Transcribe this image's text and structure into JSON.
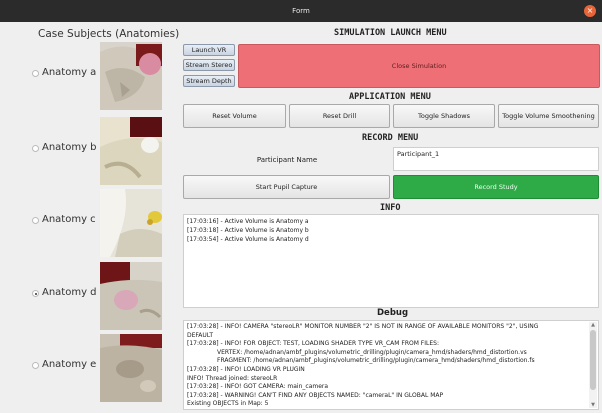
{
  "window": {
    "title": "Form"
  },
  "left_panel": {
    "title": "Case Subjects (Anatomies)",
    "items": [
      {
        "label": "Anatomy a",
        "checked": false
      },
      {
        "label": "Anatomy b",
        "checked": false
      },
      {
        "label": "Anatomy c",
        "checked": false
      },
      {
        "label": "Anatomy d",
        "checked": true
      },
      {
        "label": "Anatomy e",
        "checked": false
      }
    ]
  },
  "simulation": {
    "title": "SIMULATION LAUNCH MENU",
    "launch_vr": "Launch VR",
    "stream_stereo": "Stream Stereo",
    "stream_depth": "Stream Depth",
    "close_simulation": "Close Simulation"
  },
  "application": {
    "title": "APPLICATION MENU",
    "reset_volume": "Reset Volume",
    "reset_drill": "Reset Drill",
    "toggle_shadows": "Toggle Shadows",
    "toggle_volume_smoothening": "Toggle Volume Smoothening"
  },
  "record": {
    "title": "RECORD MENU",
    "participant_label": "Participant Name",
    "participant_value": "Participant_1",
    "start_pupil": "Start Pupil Capture",
    "record_study": "Record Study"
  },
  "info": {
    "title": "INFO",
    "lines": [
      "[17:03:16] - Active Volume is Anatomy a",
      "[17:03:18] - Active Volume is Anatomy b",
      "[17:03:54] - Active Volume is Anatomy d"
    ]
  },
  "debug": {
    "title": "Debug",
    "lines": [
      "[17:03:28] - INFO! CAMERA \"stereoLR\" MONITOR NUMBER \"2\" IS NOT IN RANGE OF AVAILABLE MONITORS \"2\", USING",
      "DEFAULT",
      "[17:03:28] - INFO! FOR OBJECT: TEST, LOADING SHADER TYPE VR_CAM FROM FILES:",
      "VERTEX: /home/adnan/ambf_plugins/volumetric_drilling/plugin/camera_hmd/shaders/hmd_distortion.vs",
      "FRAGMENT: /home/adnan/ambf_plugins/volumetric_drilling/plugin/camera_hmd/shaders/hmd_distortion.fs",
      "[17:03:28] - INFO! LOADING VR PLUGIN",
      "INFO! Thread joined: stereoLR",
      "[17:03:28] - INFO! GOT CAMERA: main_camera",
      "[17:03:28] - WARNING! CAN'T FIND ANY OBJECTS NAMED: \"cameraL\" IN GLOBAL MAP",
      "Existing OBJECTS in Map: 5"
    ],
    "indented": [
      false,
      false,
      false,
      true,
      true,
      false,
      false,
      false,
      false,
      false
    ]
  },
  "colors": {
    "close_simulation": "#ef6f76",
    "record_study": "#2eaa47",
    "titlebar": "#2b2b2b",
    "window_close": "#e8653a"
  }
}
